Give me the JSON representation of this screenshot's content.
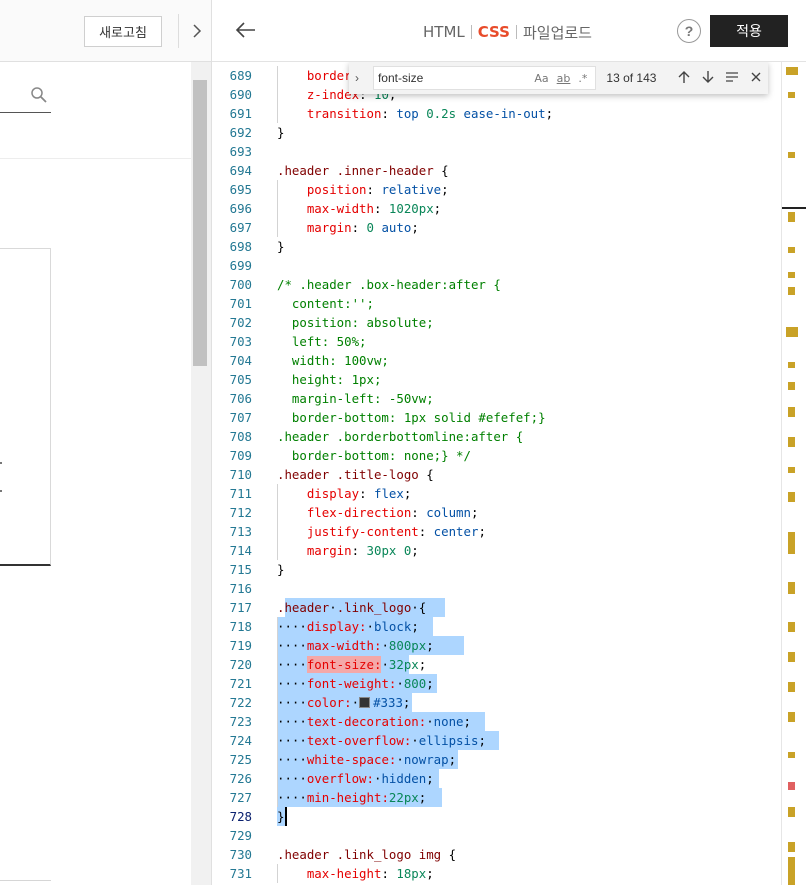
{
  "left": {
    "refresh_label": "새로고침"
  },
  "header": {
    "tabs": [
      {
        "label": "HTML",
        "active": false
      },
      {
        "label": "CSS",
        "active": true
      },
      {
        "label": "파일업로드",
        "active": false
      }
    ],
    "help_label": "?",
    "apply_label": "적용"
  },
  "find": {
    "query": "font-size",
    "opt_case": "Aa",
    "opt_word": "ab",
    "opt_regex": ".*",
    "count": "13 of 143"
  },
  "editor": {
    "first_line": 689,
    "current_line": 728,
    "lines": [
      [
        [
          "    ",
          "ws"
        ],
        [
          "border",
          "prop"
        ]
      ],
      [
        [
          "    ",
          "ws"
        ],
        [
          "z-index",
          "prop"
        ],
        [
          ": ",
          "p"
        ],
        [
          "10",
          "num"
        ],
        [
          ";",
          "p"
        ]
      ],
      [
        [
          "    ",
          "ws"
        ],
        [
          "transition",
          "prop"
        ],
        [
          ": ",
          "p"
        ],
        [
          "top ",
          "val"
        ],
        [
          "0.2s",
          "num"
        ],
        [
          " ease-in-out",
          "val"
        ],
        [
          ";",
          "p"
        ]
      ],
      [
        [
          "}",
          "p"
        ]
      ],
      [],
      [
        [
          ".header .inner-header",
          "sel"
        ],
        [
          " {",
          "p"
        ]
      ],
      [
        [
          "    ",
          "ws"
        ],
        [
          "position",
          "prop"
        ],
        [
          ": ",
          "p"
        ],
        [
          "relative",
          "val"
        ],
        [
          ";",
          "p"
        ]
      ],
      [
        [
          "    ",
          "ws"
        ],
        [
          "max-width",
          "prop"
        ],
        [
          ": ",
          "p"
        ],
        [
          "1020px",
          "num"
        ],
        [
          ";",
          "p"
        ]
      ],
      [
        [
          "    ",
          "ws"
        ],
        [
          "margin",
          "prop"
        ],
        [
          ": ",
          "p"
        ],
        [
          "0",
          "num"
        ],
        [
          " auto",
          "val"
        ],
        [
          ";",
          "p"
        ]
      ],
      [
        [
          "}",
          "p"
        ]
      ],
      [],
      [
        [
          "/* .header .box-header:after {",
          "cmt"
        ]
      ],
      [
        [
          "  content:'';",
          "cmt"
        ]
      ],
      [
        [
          "  position: absolute;",
          "cmt"
        ]
      ],
      [
        [
          "  left: 50%;",
          "cmt"
        ]
      ],
      [
        [
          "  width: 100vw;",
          "cmt"
        ]
      ],
      [
        [
          "  height: 1px;",
          "cmt"
        ]
      ],
      [
        [
          "  margin-left: -50vw;",
          "cmt"
        ]
      ],
      [
        [
          "  border-bottom: 1px solid #efefef;}",
          "cmt"
        ]
      ],
      [
        [
          ".header .borderbottomline:after {",
          "cmt"
        ]
      ],
      [
        [
          "  border-bottom: none;} */",
          "cmt"
        ]
      ],
      [
        [
          ".header .title-logo",
          "sel"
        ],
        [
          " {",
          "p"
        ]
      ],
      [
        [
          "    ",
          "ws"
        ],
        [
          "display",
          "prop"
        ],
        [
          ": ",
          "p"
        ],
        [
          "flex",
          "val"
        ],
        [
          ";",
          "p"
        ]
      ],
      [
        [
          "    ",
          "ws"
        ],
        [
          "flex-direction",
          "prop"
        ],
        [
          ": ",
          "p"
        ],
        [
          "column",
          "val"
        ],
        [
          ";",
          "p"
        ]
      ],
      [
        [
          "    ",
          "ws"
        ],
        [
          "justify-content",
          "prop"
        ],
        [
          ": ",
          "p"
        ],
        [
          "center",
          "val"
        ],
        [
          ";",
          "p"
        ]
      ],
      [
        [
          "    ",
          "ws"
        ],
        [
          "margin",
          "prop"
        ],
        [
          ": ",
          "p"
        ],
        [
          "30px 0",
          "num"
        ],
        [
          ";",
          "p"
        ]
      ],
      [
        [
          "}",
          "p"
        ]
      ],
      [],
      [
        [
          ".header",
          "sel"
        ],
        [
          "·",
          "ws"
        ],
        [
          ".link_logo",
          "sel"
        ],
        [
          "·",
          "ws"
        ],
        [
          "{",
          "p"
        ]
      ],
      [
        [
          "····",
          "ws"
        ],
        [
          "display:",
          "prop"
        ],
        [
          "·",
          "ws"
        ],
        [
          "block",
          "val"
        ],
        [
          ";",
          "p"
        ]
      ],
      [
        [
          "····",
          "ws"
        ],
        [
          "max-width:",
          "prop"
        ],
        [
          "·",
          "ws"
        ],
        [
          "800px",
          "num"
        ],
        [
          ";",
          "p"
        ]
      ],
      [
        [
          "····",
          "ws"
        ],
        [
          "font-size:",
          "prop"
        ],
        [
          "·",
          "ws"
        ],
        [
          "32px",
          "num"
        ],
        [
          ";",
          "p"
        ]
      ],
      [
        [
          "····",
          "ws"
        ],
        [
          "font-weight:",
          "prop"
        ],
        [
          "·",
          "ws"
        ],
        [
          "800",
          "num"
        ],
        [
          ";",
          "p"
        ]
      ],
      [
        [
          "····",
          "ws"
        ],
        [
          "color:",
          "prop"
        ],
        [
          "·",
          "ws"
        ],
        [
          "§",
          "swatch"
        ],
        [
          "#333",
          "val"
        ],
        [
          ";",
          "p"
        ]
      ],
      [
        [
          "····",
          "ws"
        ],
        [
          "text-decoration:",
          "prop"
        ],
        [
          "·",
          "ws"
        ],
        [
          "none",
          "val"
        ],
        [
          ";",
          "p"
        ]
      ],
      [
        [
          "····",
          "ws"
        ],
        [
          "text-overflow:",
          "prop"
        ],
        [
          "·",
          "ws"
        ],
        [
          "ellipsis",
          "val"
        ],
        [
          ";",
          "p"
        ]
      ],
      [
        [
          "····",
          "ws"
        ],
        [
          "white-space:",
          "prop"
        ],
        [
          "·",
          "ws"
        ],
        [
          "nowrap",
          "val"
        ],
        [
          ";",
          "p"
        ]
      ],
      [
        [
          "····",
          "ws"
        ],
        [
          "overflow:",
          "prop"
        ],
        [
          "·",
          "ws"
        ],
        [
          "hidden",
          "val"
        ],
        [
          ";",
          "p"
        ]
      ],
      [
        [
          "····",
          "ws"
        ],
        [
          "min-height:",
          "prop"
        ],
        [
          "22px",
          "num"
        ],
        [
          ";",
          "p"
        ]
      ],
      [
        [
          "}",
          "p"
        ]
      ],
      [],
      [
        [
          ".header .link_logo img",
          "sel"
        ],
        [
          " {",
          "p"
        ]
      ],
      [
        [
          "    ",
          "ws"
        ],
        [
          "max-height",
          "prop"
        ],
        [
          ": ",
          "p"
        ],
        [
          "18px",
          "num"
        ],
        [
          ";",
          "p"
        ]
      ]
    ]
  }
}
